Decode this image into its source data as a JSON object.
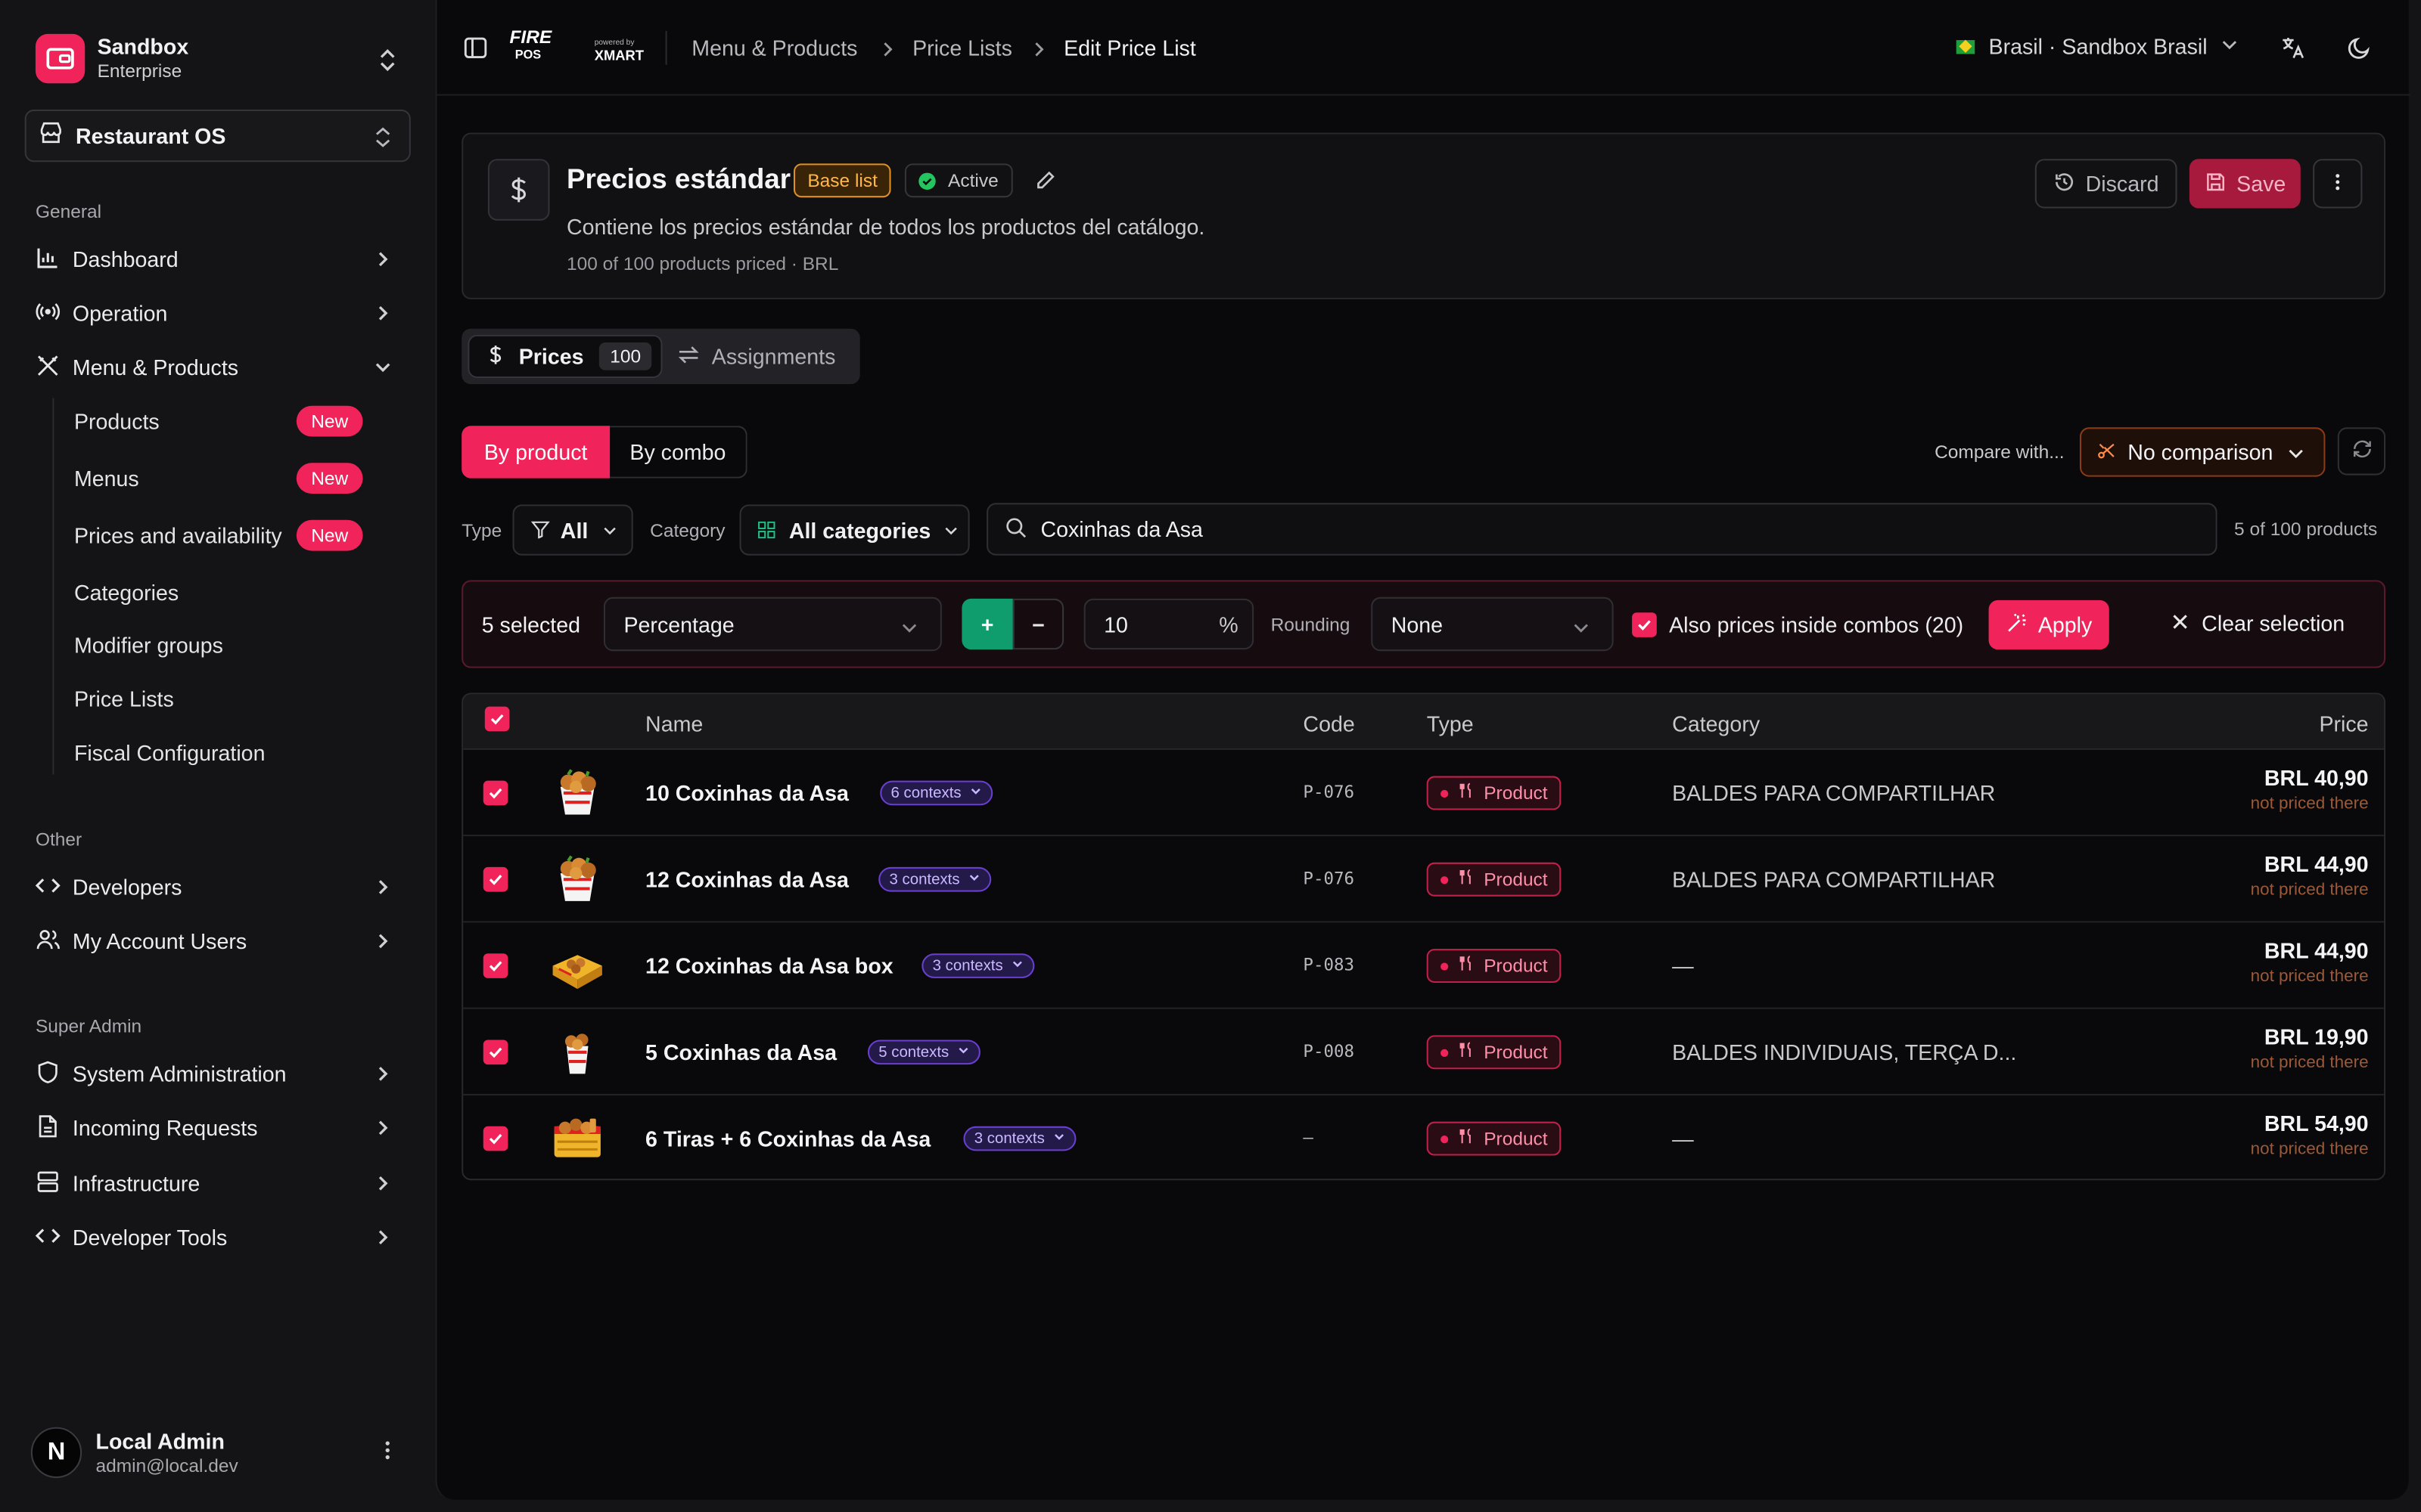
{
  "org": {
    "name": "Sandbox",
    "plan": "Enterprise"
  },
  "app": {
    "name": "Restaurant OS"
  },
  "sidebar": {
    "general_label": "General",
    "general": [
      {
        "label": "Dashboard"
      },
      {
        "label": "Operation"
      },
      {
        "label": "Menu & Products"
      }
    ],
    "menu_sub": [
      {
        "label": "Products",
        "badge": "New"
      },
      {
        "label": "Menus",
        "badge": "New"
      },
      {
        "label": "Prices and availability",
        "badge": "New"
      },
      {
        "label": "Categories"
      },
      {
        "label": "Modifier groups"
      },
      {
        "label": "Price Lists"
      },
      {
        "label": "Fiscal Configuration"
      }
    ],
    "other_label": "Other",
    "other": [
      {
        "label": "Developers"
      },
      {
        "label": "My Account Users"
      }
    ],
    "super_label": "Super Admin",
    "super": [
      {
        "label": "System Administration"
      },
      {
        "label": "Incoming Requests"
      },
      {
        "label": "Infrastructure"
      },
      {
        "label": "Developer Tools"
      }
    ]
  },
  "user": {
    "initial": "N",
    "name": "Local Admin",
    "email": "admin@local.dev"
  },
  "topbar": {
    "logo_main": "FIRE",
    "logo_sub": "POS",
    "powered": "powered by",
    "brand2": "XMART",
    "breadcrumb": [
      "Menu & Products",
      "Price Lists",
      "Edit Price List"
    ],
    "region": "Brasil · Sandbox Brasil"
  },
  "pricelist": {
    "title": "Precios estándar",
    "base_badge": "Base list",
    "status": "Active",
    "description": "Contiene los precios estándar de todos los productos del catálogo.",
    "meta": "100 of 100 products priced · BRL",
    "discard": "Discard",
    "save": "Save"
  },
  "tabs": {
    "prices": "Prices",
    "prices_count": "100",
    "assignments": "Assignments"
  },
  "view": {
    "by_product": "By product",
    "by_combo": "By combo",
    "compare_label": "Compare with...",
    "compare_value": "No comparison"
  },
  "filters": {
    "type_label": "Type",
    "type_value": "All",
    "category_label": "Category",
    "category_value": "All categories",
    "search_value": "Coxinhas da Asa",
    "result_count": "5 of 100 products"
  },
  "bulk": {
    "selected": "5 selected",
    "mode": "Percentage",
    "plus": "+",
    "minus": "−",
    "amount": "10",
    "unit": "%",
    "rounding_label": "Rounding",
    "rounding_value": "None",
    "combos_label": "Also prices inside combos (20)",
    "apply": "Apply",
    "clear": "Clear selection"
  },
  "table": {
    "headers": {
      "name": "Name",
      "code": "Code",
      "type": "Type",
      "category": "Category",
      "price": "Price"
    },
    "rows": [
      {
        "name": "10 Coxinhas da Asa",
        "contexts": "6 contexts",
        "code": "P-076",
        "type": "Product",
        "category": "BALDES PARA COMPARTILHAR",
        "price": "BRL 40,90",
        "note": "not priced there"
      },
      {
        "name": "12 Coxinhas da Asa",
        "contexts": "3 contexts",
        "code": "P-076",
        "type": "Product",
        "category": "BALDES PARA COMPARTILHAR",
        "price": "BRL 44,90",
        "note": "not priced there"
      },
      {
        "name": "12 Coxinhas da Asa box",
        "contexts": "3 contexts",
        "code": "P-083",
        "type": "Product",
        "category": "—",
        "price": "BRL 44,90",
        "note": "not priced there"
      },
      {
        "name": "5 Coxinhas da Asa",
        "contexts": "5 contexts",
        "code": "P-008",
        "type": "Product",
        "category": "BALDES INDIVIDUAIS, TERÇA D...",
        "price": "BRL 19,90",
        "note": "not priced there"
      },
      {
        "name": "6 Tiras + 6 Coxinhas da Asa",
        "contexts": "3 contexts",
        "code": "—",
        "type": "Product",
        "category": "—",
        "price": "BRL 54,90",
        "note": "not priced there"
      }
    ]
  },
  "colors": {
    "accent": "#f0245a",
    "success": "#0f9d6e",
    "context": "#6a3fd0"
  },
  "icons": [
    "wallet-icon",
    "store-icon",
    "chart-icon",
    "radio-icon",
    "utensils-icon",
    "code-icon",
    "users-icon",
    "shield-icon",
    "file-icon",
    "server-icon",
    "sidebar-toggle-icon",
    "translate-icon",
    "moon-icon",
    "dollar-icon",
    "pencil-icon",
    "history-icon",
    "save-icon",
    "more-vertical-icon",
    "swap-icon",
    "filter-icon",
    "grid-icon",
    "search-icon",
    "wand-icon",
    "close-icon",
    "refresh-icon",
    "scissors-icon"
  ]
}
